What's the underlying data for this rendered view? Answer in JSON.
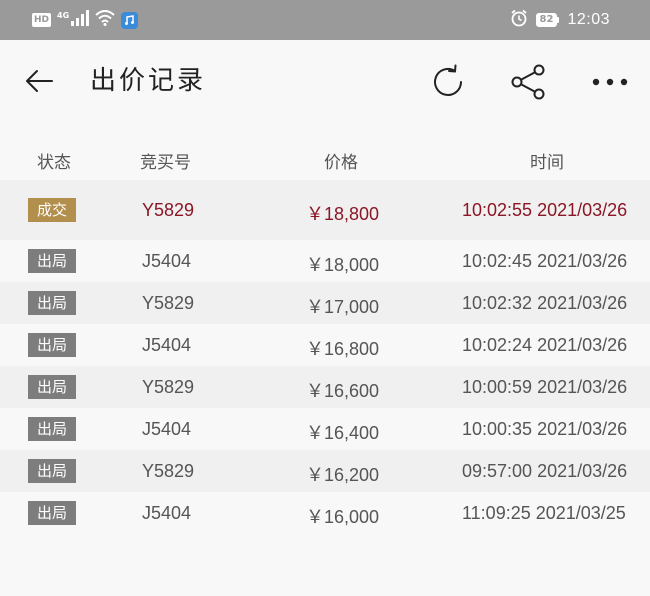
{
  "status_bar": {
    "hd": "HD",
    "network": "4G",
    "battery": "82",
    "time": "12:03",
    "icons": [
      "signal-icon",
      "wifi-icon",
      "app-notification-icon",
      "alarm-icon",
      "battery-icon"
    ]
  },
  "header": {
    "title": "出价记录",
    "icons": [
      "back-arrow-icon",
      "refresh-icon",
      "share-icon",
      "more-icon"
    ]
  },
  "table": {
    "columns": [
      "状态",
      "竞买号",
      "价格",
      "时间"
    ],
    "rows": [
      {
        "status": "成交",
        "bidder": "Y5829",
        "price": "￥18,800",
        "time": "10:02:55 2021/03/26"
      },
      {
        "status": "出局",
        "bidder": "J5404",
        "price": "￥18,000",
        "time": "10:02:45 2021/03/26"
      },
      {
        "status": "出局",
        "bidder": "Y5829",
        "price": "￥17,000",
        "time": "10:02:32 2021/03/26"
      },
      {
        "status": "出局",
        "bidder": "J5404",
        "price": "￥16,800",
        "time": "10:02:24 2021/03/26"
      },
      {
        "status": "出局",
        "bidder": "Y5829",
        "price": "￥16,600",
        "time": "10:00:59 2021/03/26"
      },
      {
        "status": "出局",
        "bidder": "J5404",
        "price": "￥16,400",
        "time": "10:00:35 2021/03/26"
      },
      {
        "status": "出局",
        "bidder": "Y5829",
        "price": "￥16,200",
        "time": "09:57:00 2021/03/26"
      },
      {
        "status": "出局",
        "bidder": "J5404",
        "price": "￥16,000",
        "time": "11:09:25 2021/03/25"
      }
    ]
  },
  "colors": {
    "winner_text": "#8b1626",
    "winner_badge": "#b28f4c",
    "out_badge": "#7d7d7d",
    "status_bar": "#9a9a9a"
  }
}
